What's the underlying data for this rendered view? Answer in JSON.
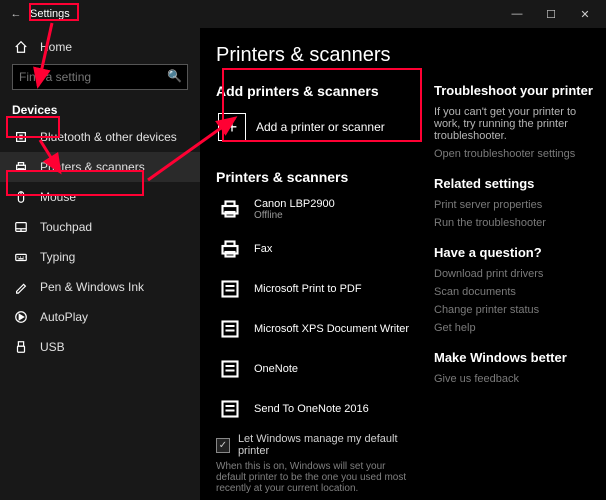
{
  "titlebar": {
    "back": "←",
    "title": "Settings",
    "min": "—",
    "max": "☐",
    "close": "✕"
  },
  "sidebar": {
    "home": "Home",
    "search_placeholder": "Find a setting",
    "section": "Devices",
    "items": [
      {
        "label": "Bluetooth & other devices"
      },
      {
        "label": "Printers & scanners"
      },
      {
        "label": "Mouse"
      },
      {
        "label": "Touchpad"
      },
      {
        "label": "Typing"
      },
      {
        "label": "Pen & Windows Ink"
      },
      {
        "label": "AutoPlay"
      },
      {
        "label": "USB"
      }
    ]
  },
  "main": {
    "title": "Printers & scanners",
    "add_section": {
      "header": "Add printers & scanners",
      "action": "Add a printer or scanner"
    },
    "list_header": "Printers & scanners",
    "devices": [
      {
        "name": "Canon LBP2900",
        "status": "Offline"
      },
      {
        "name": "Fax",
        "status": ""
      },
      {
        "name": "Microsoft Print to PDF",
        "status": ""
      },
      {
        "name": "Microsoft XPS Document Writer",
        "status": ""
      },
      {
        "name": "OneNote",
        "status": ""
      },
      {
        "name": "Send To OneNote 2016",
        "status": ""
      }
    ],
    "default_chk": "Let Windows manage my default printer",
    "default_desc": "When this is on, Windows will set your default printer to be the one you used most recently at your current location."
  },
  "right": {
    "troubleshoot": {
      "header": "Troubleshoot your printer",
      "text": "If you can't get your printer to work, try running the printer troubleshooter.",
      "link": "Open troubleshooter settings"
    },
    "related": {
      "header": "Related settings",
      "links": [
        "Print server properties",
        "Run the troubleshooter"
      ]
    },
    "question": {
      "header": "Have a question?",
      "links": [
        "Download print drivers",
        "Scan documents",
        "Change printer status",
        "Get help"
      ]
    },
    "better": {
      "header": "Make Windows better",
      "links": [
        "Give us feedback"
      ]
    }
  }
}
